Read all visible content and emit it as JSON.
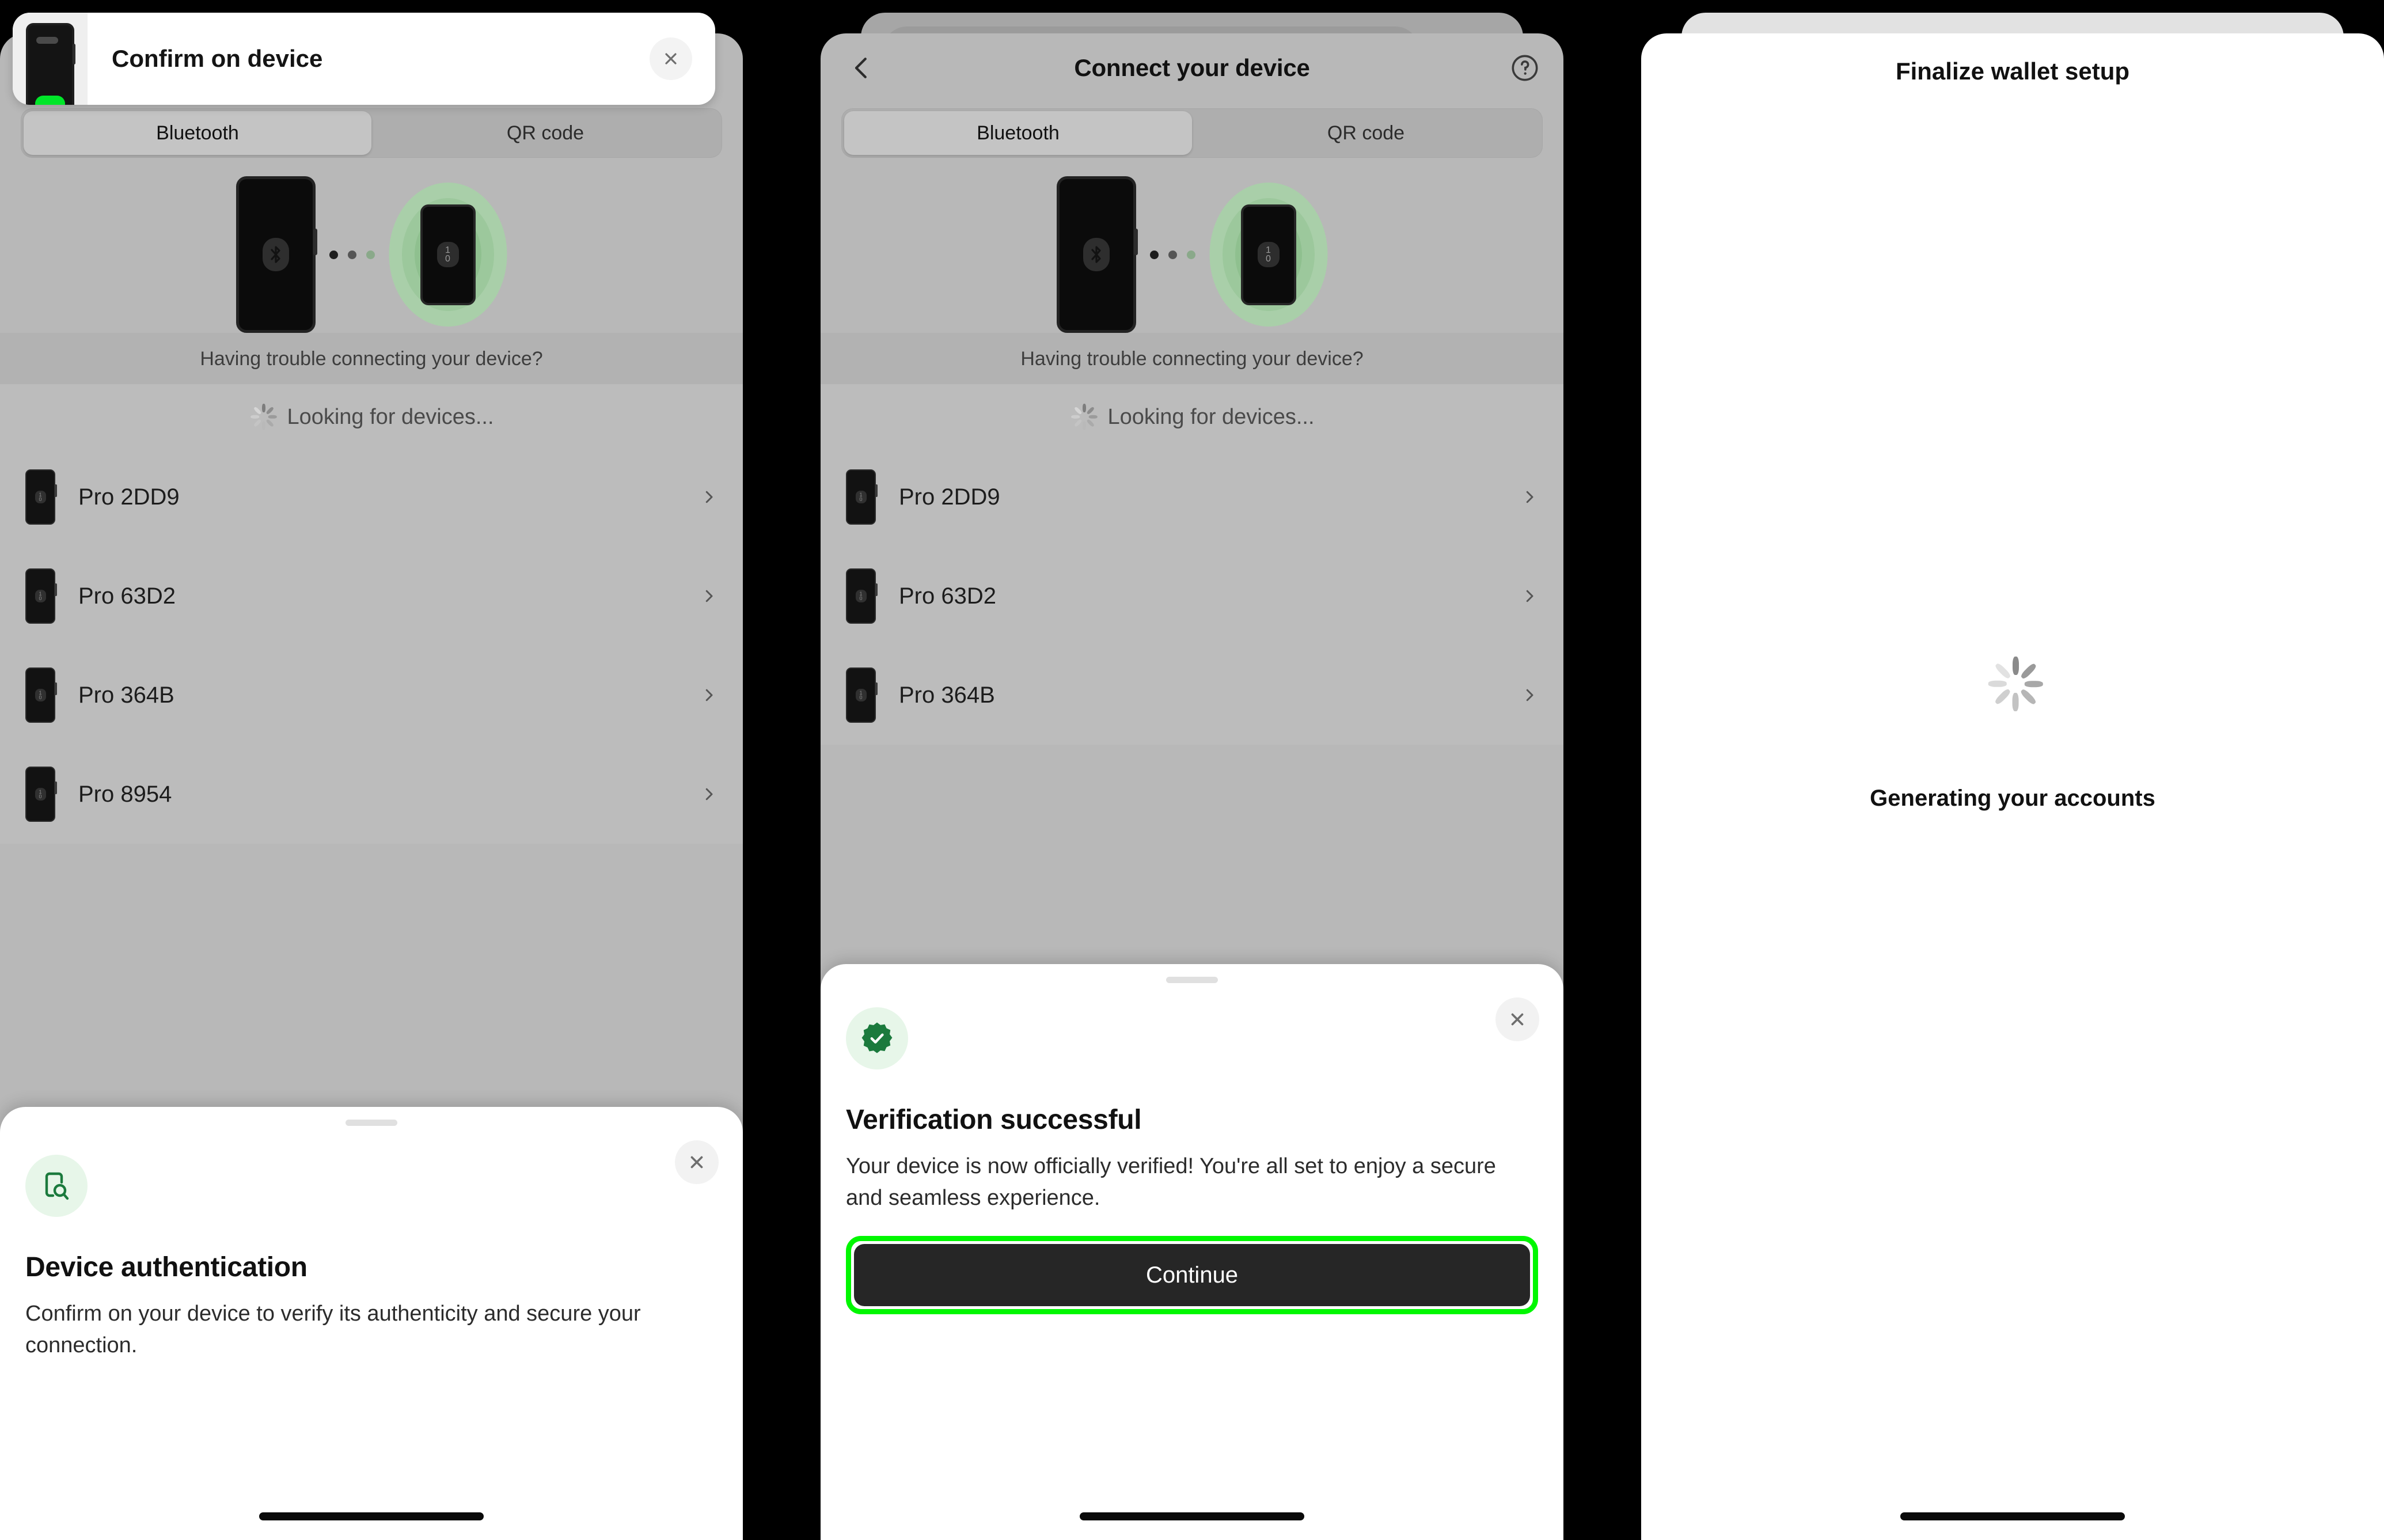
{
  "panels": [
    {
      "id": "panel-device-authentication",
      "toast": {
        "title": "Confirm on device",
        "close_icon": "close-icon",
        "device_icon": "phone-with-green-button-icon"
      },
      "segmented": {
        "options": [
          "Bluetooth",
          "QR code"
        ],
        "selected": "Bluetooth"
      },
      "illustration": {
        "bluetooth_icon": "bluetooth-icon",
        "device_icon": "ledger-device-icon",
        "caption": "Having trouble connecting your device?"
      },
      "scanning_label": "Looking for devices...",
      "devices": [
        {
          "name": "Pro 2DD9"
        },
        {
          "name": "Pro 63D2"
        },
        {
          "name": "Pro 364B"
        },
        {
          "name": "Pro 8954"
        }
      ],
      "sheet": {
        "icon": "device-scan-icon",
        "close_icon": "close-icon",
        "title": "Device authentication",
        "body": "Confirm on your device to verify its authenticity and secure your connection."
      }
    },
    {
      "id": "panel-verification-successful",
      "navbar": {
        "back_icon": "chevron-left-icon",
        "title": "Connect your device",
        "help_icon": "help-circle-icon"
      },
      "segmented": {
        "options": [
          "Bluetooth",
          "QR code"
        ],
        "selected": "Bluetooth"
      },
      "illustration": {
        "bluetooth_icon": "bluetooth-icon",
        "device_icon": "ledger-device-icon",
        "caption": "Having trouble connecting your device?"
      },
      "scanning_label": "Looking for devices...",
      "devices": [
        {
          "name": "Pro 2DD9"
        },
        {
          "name": "Pro 63D2"
        },
        {
          "name": "Pro 364B"
        }
      ],
      "sheet": {
        "icon": "verified-badge-icon",
        "close_icon": "close-icon",
        "title": "Verification successful",
        "body": "Your device is now officially verified! You're all set to enjoy a secure and seamless experience.",
        "cta_label": "Continue"
      }
    },
    {
      "id": "panel-finalize-wallet-setup",
      "title": "Finalize wallet setup",
      "spinner_icon": "loading-spinner-icon",
      "status_label": "Generating your accounts"
    }
  ],
  "colors": {
    "accent_green": "#00f700",
    "brand_green": "#1b7a3d",
    "icon_bg_green": "#e7f6e9",
    "cta_dark": "#262626",
    "screen_grey": "#b8b8b8"
  }
}
